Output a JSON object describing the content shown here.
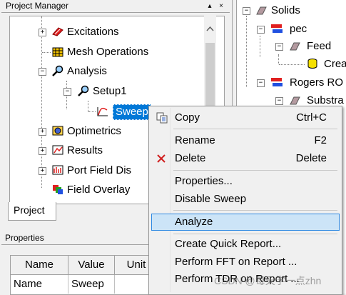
{
  "project_manager": {
    "title": "Project Manager",
    "pin_glyph": "▴",
    "close_glyph": "×",
    "tab_label": "Project",
    "tree": [
      {
        "label": "Excitations",
        "icon": "excitations-icon"
      },
      {
        "label": "Mesh Operations",
        "icon": "mesh-icon"
      },
      {
        "label": "Analysis",
        "icon": "analysis-icon"
      },
      {
        "label": "Setup1",
        "icon": "setup-icon"
      },
      {
        "label": "Sweep",
        "icon": "sweep-icon"
      },
      {
        "label": "Optimetrics",
        "icon": "optimetrics-icon"
      },
      {
        "label": "Results",
        "icon": "results-icon"
      },
      {
        "label": "Port Field Dis",
        "icon": "port-field-icon"
      },
      {
        "label": "Field Overlay",
        "icon": "field-overlay-icon"
      }
    ]
  },
  "properties": {
    "title": "Properties",
    "columns": [
      "Name",
      "Value",
      "Unit"
    ],
    "row": {
      "name": "Name",
      "value": "Sweep"
    }
  },
  "right_tree": [
    {
      "label": "Solids"
    },
    {
      "label": "pec"
    },
    {
      "label": "Feed"
    },
    {
      "label": "Crea"
    },
    {
      "label": "Rogers RO"
    },
    {
      "label": "Substra"
    }
  ],
  "context_menu": {
    "items": [
      {
        "label": "Copy",
        "shortcut": "Ctrl+C"
      },
      {
        "label": "Rename",
        "shortcut": "F2"
      },
      {
        "label": "Delete",
        "shortcut": "Delete"
      },
      {
        "label": "Properties..."
      },
      {
        "label": "Disable Sweep"
      },
      {
        "label": "Analyze"
      },
      {
        "label": "Create Quick Report..."
      },
      {
        "label": "Perform FFT on Report ..."
      },
      {
        "label": "Perform TDR on Report ..."
      }
    ]
  },
  "watermark": "CSDN @每天学一点zhn",
  "colors": {
    "selection": "#0078d7",
    "menu_highlight": "#cce4f7",
    "menu_highlight_border": "#2f8ae3"
  }
}
